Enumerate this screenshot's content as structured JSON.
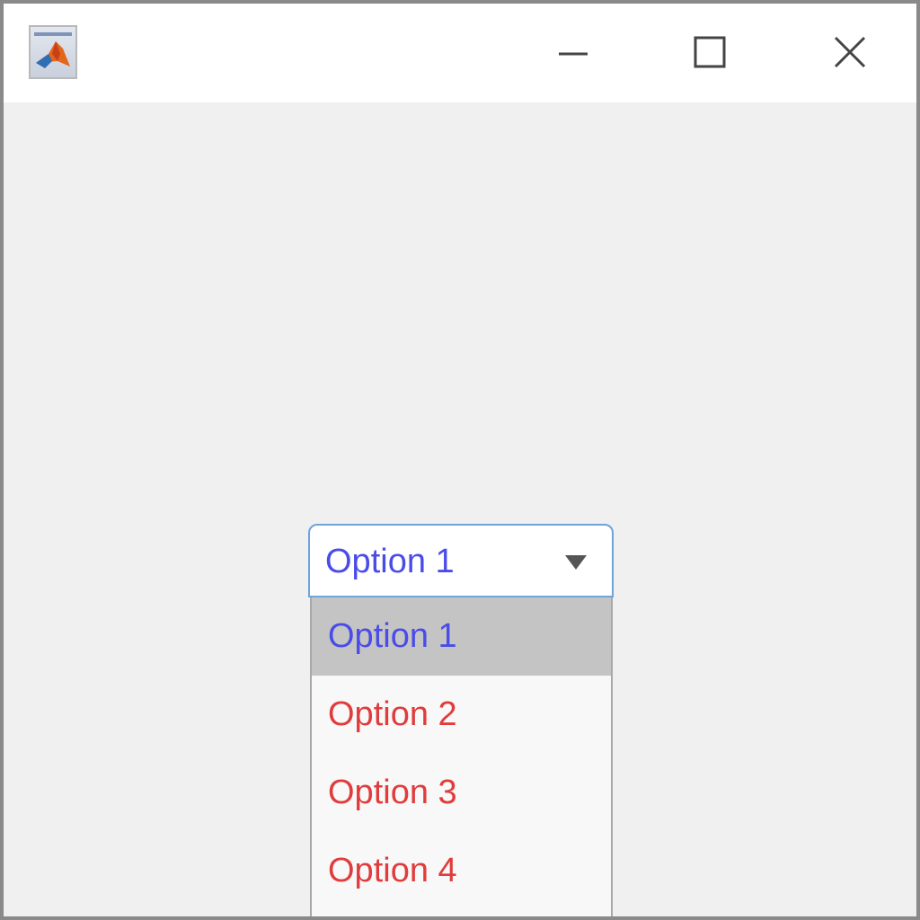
{
  "window": {
    "app_icon": "matlab-logo-icon",
    "controls": {
      "minimize_icon": "minimize-icon",
      "maximize_icon": "maximize-icon",
      "close_icon": "close-icon"
    }
  },
  "dropdown": {
    "value": "Option 1",
    "arrow_icon": "triangle-down-icon",
    "options": [
      {
        "label": "Option 1",
        "selected": true
      },
      {
        "label": "Option 2",
        "selected": false
      },
      {
        "label": "Option 3",
        "selected": false
      },
      {
        "label": "Option 4",
        "selected": false
      }
    ]
  },
  "colors": {
    "selected_text": "#4a4ce8",
    "option_text": "#e03c3c",
    "selected_background": "#c4c4c4",
    "focus_border": "#6fa3dc",
    "window_background": "#f0f0f0"
  }
}
